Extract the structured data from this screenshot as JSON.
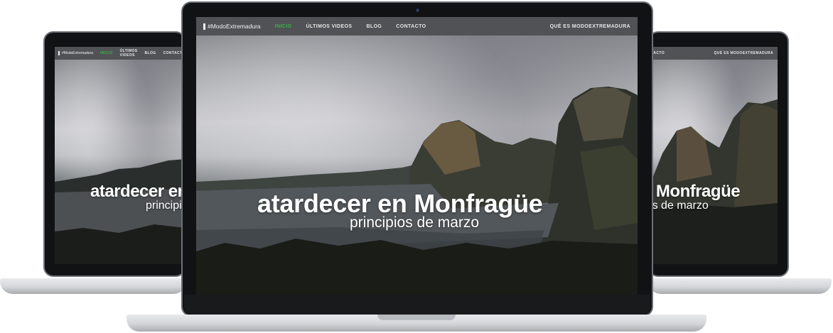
{
  "website": {
    "brand": "#ModoExtremadura",
    "nav_items": [
      "INICIO",
      "ÚLTIMOS VIDEOS",
      "BLOG",
      "CONTACTO"
    ],
    "nav_right": "QUÉ ES MODOEXTREMADURA",
    "hero_title": "atardecer en Monfragüe",
    "hero_subtitle": "principios de marzo"
  },
  "colors": {
    "nav_bg": "#505255",
    "active_nav": "#3db24b",
    "laptop_bezel": "#111214",
    "laptop_base": "#d3d5d8"
  },
  "icons": [
    "camera-icon",
    "brand-icon"
  ]
}
